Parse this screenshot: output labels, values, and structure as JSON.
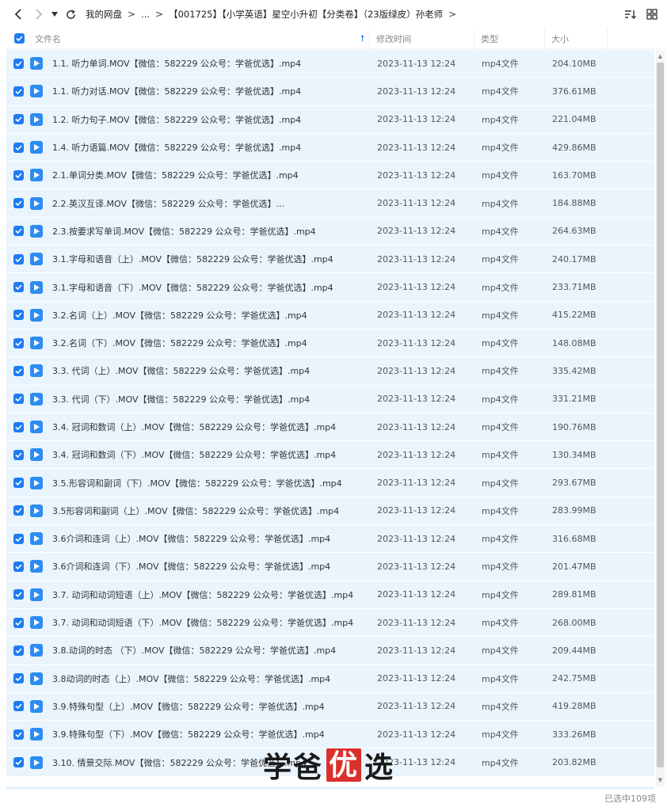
{
  "breadcrumb": [
    "我的网盘",
    "...",
    "【001725】【小学英语】星空小升初【分类卷】（23版绿皮）孙老师"
  ],
  "columns": {
    "name": "文件名",
    "time": "修改时间",
    "type": "类型",
    "size": "大小"
  },
  "files": [
    {
      "name": "1.1. 听力单词.MOV【微信：582229 公众号：学爸优选】.mp4",
      "time": "2023-11-13 12:24",
      "type": "mp4文件",
      "size": "204.10MB"
    },
    {
      "name": "1.1. 听力对话.MOV【微信：582229 公众号：学爸优选】.mp4",
      "time": "2023-11-13 12:24",
      "type": "mp4文件",
      "size": "376.61MB"
    },
    {
      "name": "1.2. 听力句子.MOV【微信：582229 公众号：学爸优选】.mp4",
      "time": "2023-11-13 12:24",
      "type": "mp4文件",
      "size": "221.04MB"
    },
    {
      "name": "1.4. 听力语篇.MOV【微信：582229 公众号：学爸优选】.mp4",
      "time": "2023-11-13 12:24",
      "type": "mp4文件",
      "size": "429.86MB"
    },
    {
      "name": "2.1.单词分类.MOV【微信：582229 公众号：学爸优选】.mp4",
      "time": "2023-11-13 12:24",
      "type": "mp4文件",
      "size": "163.70MB"
    },
    {
      "name": "2.2.英汉互译.MOV【微信：582229 公众号：学爸优选】...",
      "time": "2023-11-13 12:24",
      "type": "mp4文件",
      "size": "184.88MB"
    },
    {
      "name": "2.3.按要求写单词.MOV【微信：582229 公众号：学爸优选】.mp4",
      "time": "2023-11-13 12:24",
      "type": "mp4文件",
      "size": "264.63MB"
    },
    {
      "name": "3.1.字母和语音（上）.MOV【微信：582229 公众号：学爸优选】.mp4",
      "time": "2023-11-13 12:24",
      "type": "mp4文件",
      "size": "240.17MB"
    },
    {
      "name": "3.1.字母和语音（下）.MOV【微信：582229 公众号：学爸优选】.mp4",
      "time": "2023-11-13 12:24",
      "type": "mp4文件",
      "size": "233.71MB"
    },
    {
      "name": "3.2.名词（上）.MOV【微信：582229 公众号：学爸优选】.mp4",
      "time": "2023-11-13 12:24",
      "type": "mp4文件",
      "size": "415.22MB"
    },
    {
      "name": "3.2.名词（下）.MOV【微信：582229 公众号：学爸优选】.mp4",
      "time": "2023-11-13 12:24",
      "type": "mp4文件",
      "size": "148.08MB"
    },
    {
      "name": "3.3. 代词（上）.MOV【微信：582229 公众号：学爸优选】.mp4",
      "time": "2023-11-13 12:24",
      "type": "mp4文件",
      "size": "335.42MB"
    },
    {
      "name": "3.3. 代词（下）.MOV【微信：582229 公众号：学爸优选】.mp4",
      "time": "2023-11-13 12:24",
      "type": "mp4文件",
      "size": "331.21MB"
    },
    {
      "name": "3.4. 冠词和数词（上）.MOV【微信：582229 公众号：学爸优选】.mp4",
      "time": "2023-11-13 12:24",
      "type": "mp4文件",
      "size": "190.76MB"
    },
    {
      "name": "3.4. 冠词和数词（下）.MOV【微信：582229 公众号：学爸优选】.mp4",
      "time": "2023-11-13 12:24",
      "type": "mp4文件",
      "size": "130.34MB"
    },
    {
      "name": "3.5.形容词和副词（下）.MOV【微信：582229 公众号：学爸优选】.mp4",
      "time": "2023-11-13 12:24",
      "type": "mp4文件",
      "size": "293.67MB"
    },
    {
      "name": "3.5形容词和副词（上）.MOV【微信：582229 公众号：学爸优选】.mp4",
      "time": "2023-11-13 12:24",
      "type": "mp4文件",
      "size": "283.99MB"
    },
    {
      "name": "3.6介词和连词（上）.MOV【微信：582229 公众号：学爸优选】.mp4",
      "time": "2023-11-13 12:24",
      "type": "mp4文件",
      "size": "316.68MB"
    },
    {
      "name": "3.6介词和连词（下）.MOV【微信：582229 公众号：学爸优选】.mp4",
      "time": "2023-11-13 12:24",
      "type": "mp4文件",
      "size": "201.47MB"
    },
    {
      "name": "3.7. 动词和动词短语（上）.MOV【微信：582229 公众号：学爸优选】.mp4",
      "time": "2023-11-13 12:24",
      "type": "mp4文件",
      "size": "289.81MB"
    },
    {
      "name": "3.7. 动词和动词短语（下）.MOV【微信：582229 公众号：学爸优选】.mp4",
      "time": "2023-11-13 12:24",
      "type": "mp4文件",
      "size": "268.00MB"
    },
    {
      "name": "3.8.动词的时态 （下）.MOV【微信：582229 公众号：学爸优选】.mp4",
      "time": "2023-11-13 12:24",
      "type": "mp4文件",
      "size": "209.44MB"
    },
    {
      "name": "3.8动词的时态（上）.MOV【微信：582229 公众号：学爸优选】.mp4",
      "time": "2023-11-13 12:24",
      "type": "mp4文件",
      "size": "242.75MB"
    },
    {
      "name": "3.9.特殊句型（上）.MOV【微信：582229 公众号：学爸优选】.mp4",
      "time": "2023-11-13 12:24",
      "type": "mp4文件",
      "size": "419.28MB"
    },
    {
      "name": "3.9.特殊句型（下）.MOV【微信：582229 公众号：学爸优选】.mp4",
      "time": "2023-11-13 12:24",
      "type": "mp4文件",
      "size": "333.26MB"
    },
    {
      "name": "3.10. 情景交际.MOV【微信：582229 公众号：学爸优选】.mp4",
      "time": "2023-11-13 12:24",
      "type": "mp4文件",
      "size": "203.82MB"
    }
  ],
  "status": "已选中109项",
  "watermark": {
    "part1": "学爸",
    "highlight": "优",
    "part2": "选"
  },
  "colors": {
    "accent": "#1e7cf2",
    "row_selected": "#e9f4fd",
    "watermark_red": "#d9302c"
  },
  "icons": [
    "back-arrow-icon",
    "forward-arrow-icon",
    "dropdown-icon",
    "refresh-icon",
    "sort-icon",
    "grid-view-icon",
    "checkbox-icon",
    "video-file-icon"
  ]
}
